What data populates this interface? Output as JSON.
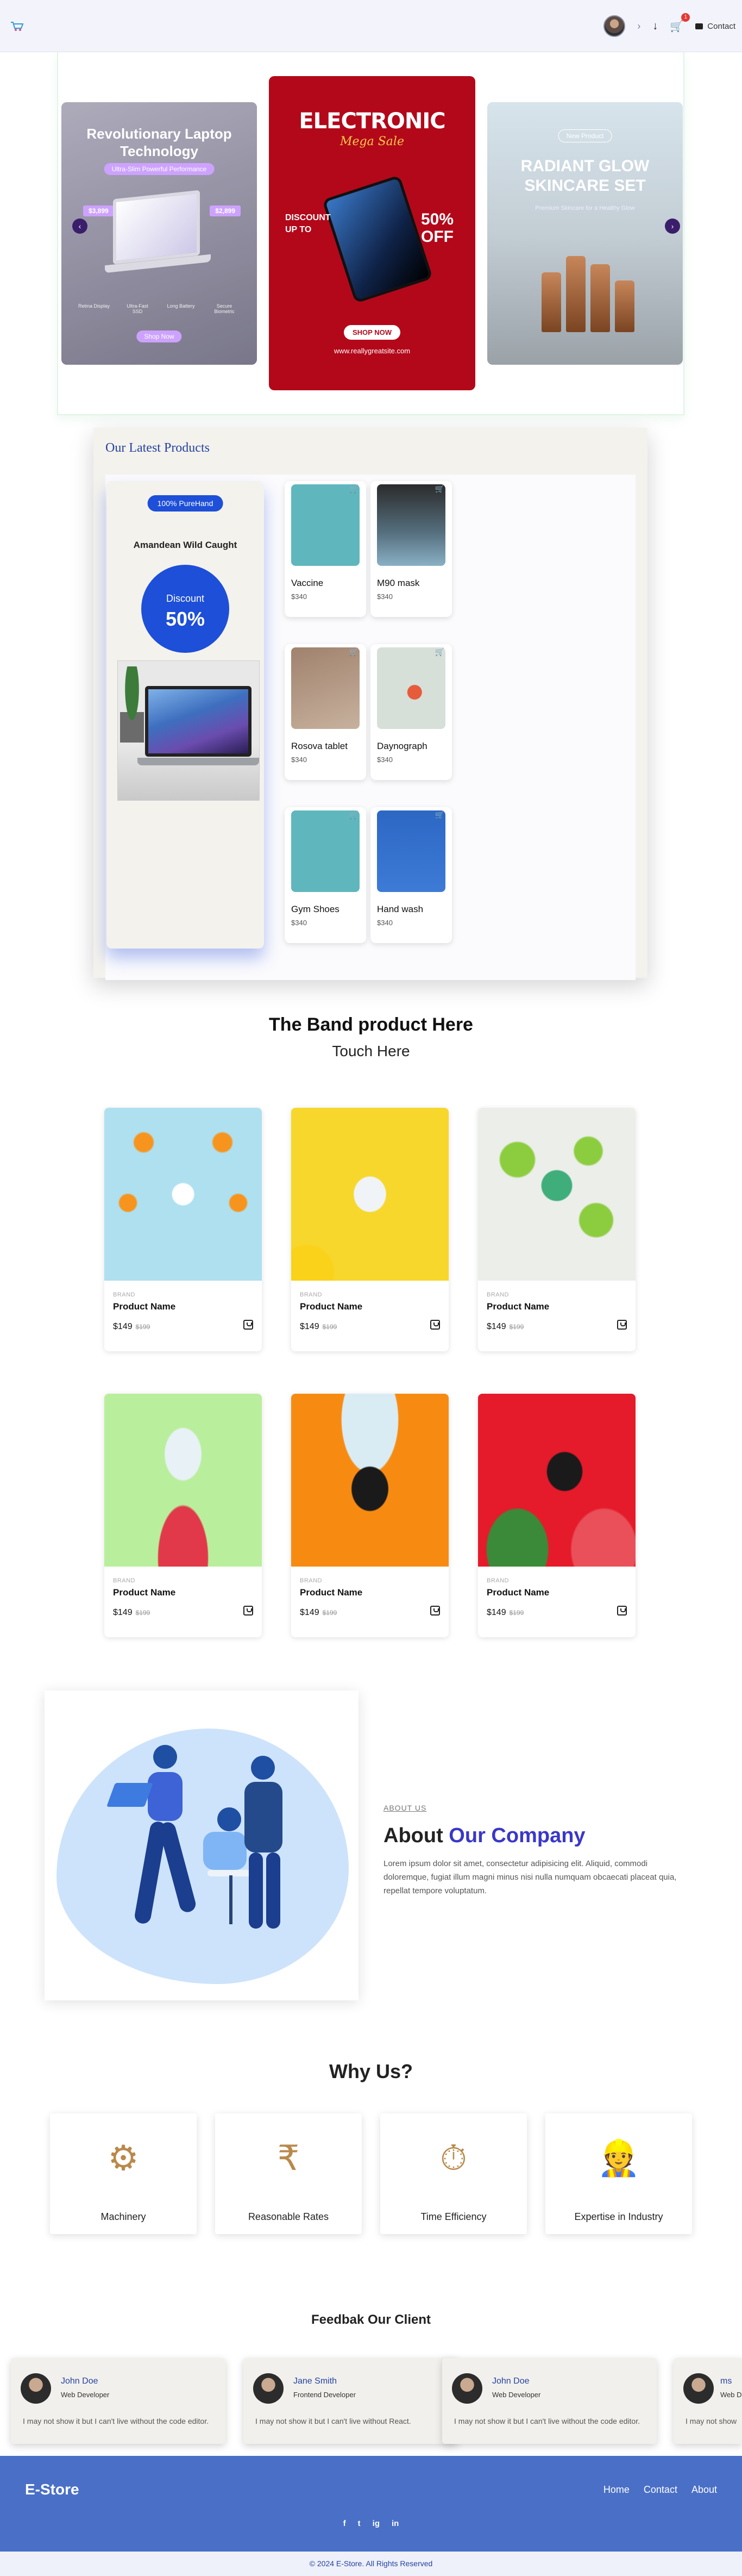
{
  "nav": {
    "logo_icon": "cart-logo-icon",
    "contact_label": "Contact",
    "cart_count": "1"
  },
  "carousel": {
    "left": {
      "title": "Revolutionary Laptop Technology",
      "pill": "Ultra-Slim Powerful Performance",
      "old_price": "$3,899",
      "new_price": "$2,899",
      "specs": [
        "Retina Display",
        "Ultra-Fast SSD",
        "Long Battery",
        "Secure Biometric"
      ],
      "cta": "Shop Now"
    },
    "middle": {
      "title": "ELECTRONIC",
      "script": "Mega Sale",
      "discount_left": "DISCOUNT UP TO",
      "discount_right": "50% OFF",
      "cta": "SHOP NOW",
      "site": "www.reallygreatsite.com"
    },
    "right": {
      "pill": "New Product",
      "title": "RADIANT GLOW SKINCARE SET",
      "subtitle": "Premium Skincare for a Healthy Glow"
    }
  },
  "latest": {
    "heading": "Our Latest Products",
    "promo": {
      "chip": "100% PureHand",
      "title": "Amandean Wild Caught",
      "discount_label": "Discount",
      "discount_value": "50%"
    },
    "products": [
      {
        "name": "Vaccine",
        "price": "$340",
        "color": "#5fb7bd"
      },
      {
        "name": "M90 mask",
        "price": "$340",
        "color": "#465a6a"
      },
      {
        "name": "Rosova tablet",
        "price": "$340",
        "color": "#a0826d"
      },
      {
        "name": "Daynograph",
        "price": "$340",
        "color": "#d7dfd9"
      },
      {
        "name": "Gym Shoes",
        "price": "$340",
        "color": "#5fb7bd"
      },
      {
        "name": "Hand wash",
        "price": "$340",
        "color": "#2c67c4"
      }
    ]
  },
  "band": {
    "title": "The Band product Here",
    "subtitle": "Touch Here",
    "cards": [
      {
        "brand": "BRAND",
        "name": "Product Name",
        "price": "$149",
        "old": "$199",
        "bg": "#aee0f0"
      },
      {
        "brand": "BRAND",
        "name": "Product Name",
        "price": "$149",
        "old": "$199",
        "bg": "#f7d72b"
      },
      {
        "brand": "BRAND",
        "name": "Product Name",
        "price": "$149",
        "old": "$199",
        "bg": "#eceeea"
      },
      {
        "brand": "BRAND",
        "name": "Product Name",
        "price": "$149",
        "old": "$199",
        "bg": "#b9ef9c"
      },
      {
        "brand": "BRAND",
        "name": "Product Name",
        "price": "$149",
        "old": "$199",
        "bg": "#f78b12"
      },
      {
        "brand": "BRAND",
        "name": "Product Name",
        "price": "$149",
        "old": "$199",
        "bg": "#e51a2a"
      }
    ]
  },
  "about": {
    "small": "ABOUT US",
    "heading_plain": "About ",
    "heading_accent": "Our Company",
    "body": "Lorem ipsum dolor sit amet, consectetur adipisicing elit. Aliquid, commodi doloremque, fugiat illum magni minus nisi nulla numquam obcaecati placeat quia, repellat tempore voluptatum."
  },
  "why": {
    "heading": "Why Us?",
    "items": [
      {
        "label": "Machinery",
        "icon": "gears-icon"
      },
      {
        "label": "Reasonable Rates",
        "icon": "rupee-hand-icon"
      },
      {
        "label": "Time Efficiency",
        "icon": "stopwatch-icon"
      },
      {
        "label": "Expertise in Industry",
        "icon": "worker-icon"
      }
    ]
  },
  "feedback": {
    "heading": "Feedbak Our Client",
    "items": [
      {
        "name": "John Doe",
        "role": "Web Developer",
        "text": "I may not show it but I can't live without the code editor."
      },
      {
        "name": "Jane Smith",
        "role": "Frontend Developer",
        "text": "I may not show it but I can't live without React."
      },
      {
        "name": "John Doe",
        "role": "Web Developer",
        "text": "I may not show it but I can't live without the code editor."
      },
      {
        "name": "ms",
        "role": "Web D",
        "text": "I may not show"
      }
    ]
  },
  "footer": {
    "brand": "E-Store",
    "links": [
      "Home",
      "Contact",
      "About"
    ],
    "social": [
      "f",
      "t",
      "ig",
      "in"
    ],
    "copyright": "© 2024 E-Store. All Rights Reserved"
  }
}
